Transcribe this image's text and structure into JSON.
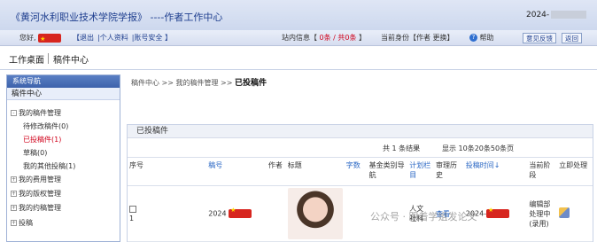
{
  "header": {
    "title": "《黄河水利职业技术学院学报》 ----作者工作中心",
    "year_prefix": "2024-"
  },
  "userbar": {
    "greeting": "您好,",
    "links": [
      "【退出",
      "|个人资料",
      "|账号安全 】"
    ],
    "inbox_prefix": "站内信息【 ",
    "inbox_count": "0条 / 共0条",
    "inbox_suffix": " 】",
    "identity": "当前身份【作者 更换】",
    "help": "帮助",
    "feedback_btn": "意见反馈",
    "back_btn": "返回"
  },
  "tabs": {
    "desk": "工作桌面",
    "center": "稿件中心"
  },
  "sidebar": {
    "heading": "系统导航",
    "subheading": "稿件中心",
    "group1": "我的稿件管理",
    "items": [
      "待修改稿件(0)",
      "已投稿件(1)",
      "草稿(0)",
      "我的其他投稿(1)"
    ],
    "groups": [
      "我的费用管理",
      "我的版权管理",
      "我的约稿管理",
      "投稿"
    ]
  },
  "breadcrumb": {
    "path": "稿件中心 >> 我的稿件管理 >> ",
    "current": "已投稿件"
  },
  "panel": {
    "title": "已投稿件",
    "result": "共 1 条结果",
    "display": "显示 10条20条50条页"
  },
  "table": {
    "headers": [
      "序号",
      "稿号",
      "作者",
      "标题",
      "字数",
      "基金类别导航",
      "计划栏目",
      "审理历史",
      "投稿时间↓",
      "当前阶段",
      "立即处理"
    ],
    "row": {
      "index": "1",
      "manuscript_no": "2024",
      "column": "人文",
      "column2": "社科",
      "history": "查看",
      "submit_time": "2024-",
      "stage": "编辑部处理中(录用)"
    }
  },
  "watermark": "公众号 · 跟着学姐发论文"
}
